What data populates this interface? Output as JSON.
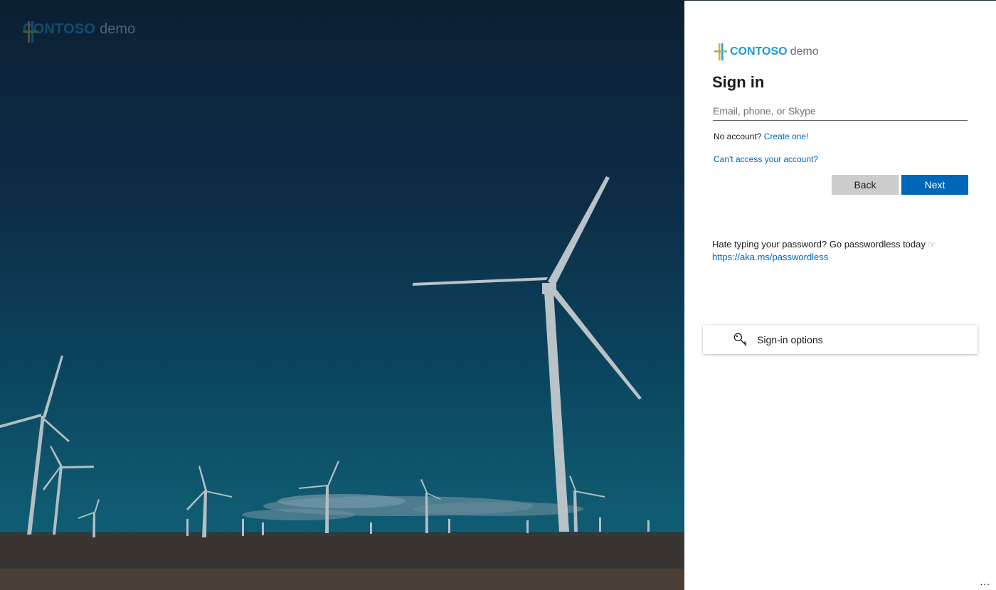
{
  "background": {
    "logo_brand": "CONTOSO",
    "logo_suffix": "demo"
  },
  "panel": {
    "logo_brand": "CONTOSO",
    "logo_suffix": "demo",
    "title": "Sign in",
    "email_placeholder": "Email, phone, or Skype",
    "email_value": "",
    "no_account_text": "No account?",
    "create_link": "Create one!",
    "cant_access_link": "Can't access your account?",
    "back_button": "Back",
    "next_button": "Next",
    "promo_text": "Hate typing your password? Go passwordless today",
    "promo_icon": "pointing-hand-icon",
    "promo_link": "https://aka.ms/passwordless",
    "options_label": "Sign-in options",
    "options_icon": "key-icon",
    "more_menu": "..."
  },
  "colors": {
    "accent": "#0067b8",
    "brand": "#1a9ad6",
    "secondary_button": "#cccccc"
  }
}
